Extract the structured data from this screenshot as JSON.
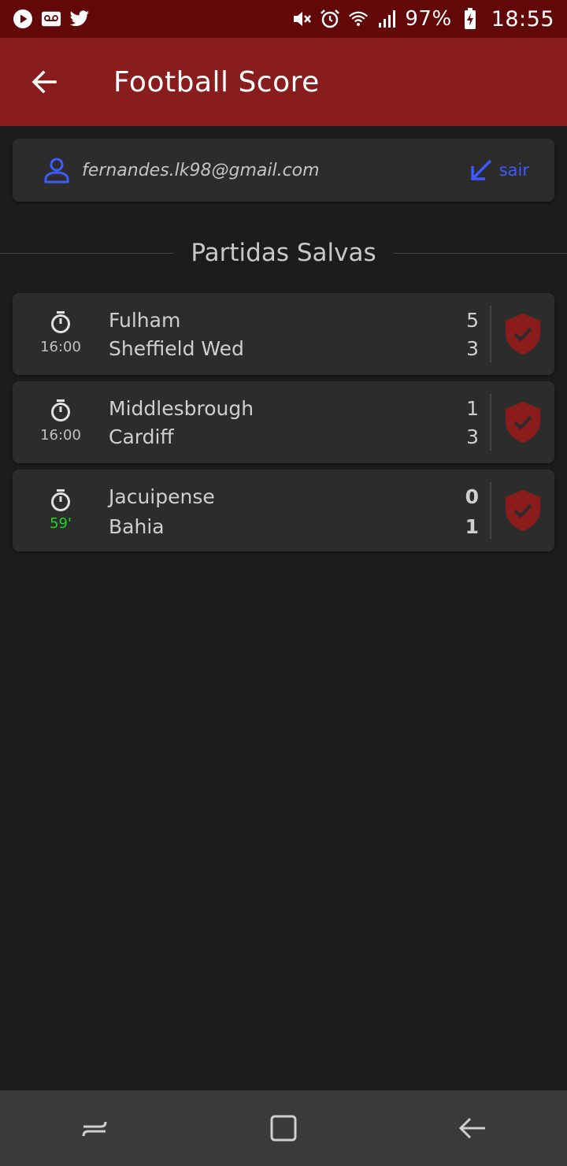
{
  "status_bar": {
    "battery": "97%",
    "time": "18:55"
  },
  "app_bar": {
    "title": "Football Score"
  },
  "user": {
    "email": "fernandes.lk98@gmail.com",
    "logout_label": "sair"
  },
  "section": {
    "title": "Partidas Salvas"
  },
  "matches": [
    {
      "time": "16:00",
      "home_team": "Fulham",
      "away_team": "Sheffield Wed",
      "home_score": "5",
      "away_score": "3",
      "live": false
    },
    {
      "time": "16:00",
      "home_team": "Middlesbrough",
      "away_team": "Cardiff",
      "home_score": "1",
      "away_score": "3",
      "live": false
    },
    {
      "time": "59'",
      "home_team": "Jacuipense",
      "away_team": "Bahia",
      "home_score": "0",
      "away_score": "1",
      "live": true
    }
  ],
  "colors": {
    "status_bar_bg": "#620808",
    "app_bar_bg": "#891d1d",
    "background": "#1c1c1c",
    "card": "#2c2c2c",
    "accent_blue": "#3d5afe",
    "live_green": "#22d422",
    "shield_red": "#8a1c1c"
  },
  "icons": {
    "status_left": [
      "play-circle-icon",
      "voicemail-icon",
      "twitter-icon"
    ],
    "status_right": [
      "mute-icon",
      "alarm-icon",
      "wifi-icon",
      "signal-icon",
      "battery-charging-icon"
    ],
    "app_bar": "arrow-back-icon",
    "user": "person-icon",
    "logout": "arrow-down-left-icon",
    "match_time": "timer-icon",
    "match_action": "shield-check-icon",
    "nav": [
      "recents-icon",
      "home-icon",
      "back-icon"
    ]
  }
}
